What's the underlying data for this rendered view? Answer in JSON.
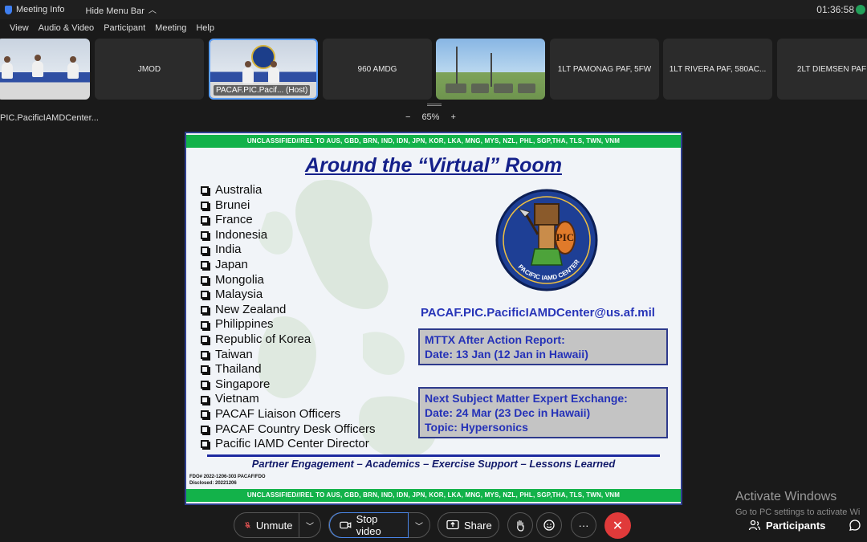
{
  "titlebar": {
    "meeting_info": "Meeting Info",
    "hide_menu_bar": "Hide Menu Bar",
    "time": "01:36:58"
  },
  "menu": [
    "View",
    "Audio & Video",
    "Participant",
    "Meeting",
    "Help"
  ],
  "thumbnails": [
    {
      "label": ""
    },
    {
      "label": "JMOD"
    },
    {
      "label": "PACAF.PIC.Pacif... (Host)"
    },
    {
      "label": "960 AMDG"
    },
    {
      "label": ""
    },
    {
      "label": "1LT PAMONAG PAF, 5FW"
    },
    {
      "label": "1LT RIVERA PAF, 580AC..."
    },
    {
      "label": "2LT DIEMSEN PAF"
    }
  ],
  "share": {
    "name": "PIC.PacificIAMDCenter...",
    "zoom_minus": "−",
    "zoom_level": "65%",
    "zoom_plus": "+"
  },
  "slide": {
    "banner": "UNCLASSIFIED//REL TO AUS, GBD, BRN, IND, IDN, JPN, KOR, LKA, MNG, MYS, NZL, PHL, SGP,THA, TLS, TWN, VNM",
    "title": "Around the “Virtual” Room",
    "countries": [
      "Australia",
      "Brunei",
      "France",
      "Indonesia",
      "India",
      "Japan",
      "Mongolia",
      "Malaysia",
      "New Zealand",
      "Philippines",
      "Republic of Korea",
      "Taiwan",
      "Thailand",
      "Singapore",
      "Vietnam",
      "PACAF Liaison Officers",
      "PACAF Country Desk Officers",
      "Pacific IAMD Center Director"
    ],
    "email": "PACAF.PIC.PacificIAMDCenter@us.af.mil",
    "box1": {
      "line1": "MTTX After Action Report:",
      "line2": "Date: 13 Jan (12 Jan in Hawaii)"
    },
    "box2": {
      "line1": "Next Subject Matter Expert Exchange:",
      "line2": "Date: 24 Mar (23 Dec in Hawaii)",
      "line3": "Topic: Hypersonics"
    },
    "tagline": "Partner Engagement – Academics – Exercise Support – Lessons Learned",
    "fdo_line1": "FDO# 2022-1206-303 PACAF/FDO",
    "fdo_line2": "Disclosed: 20221206",
    "emblem_text": "PACIFIC IAMD CENTER",
    "emblem_letters": "PIC"
  },
  "watermark": {
    "title": "Activate Windows",
    "subtitle": "Go to PC settings to activate Wi"
  },
  "toolbar": {
    "unmute": "Unmute",
    "stop_video": "Stop video",
    "share": "Share",
    "more": "···",
    "participants": "Participants"
  },
  "colors": {
    "banner_green": "#13b24a",
    "title_blue": "#14208a",
    "email_blue": "#2835b8",
    "end_red": "#e03a3a",
    "active_outline": "#5aa0ff"
  }
}
